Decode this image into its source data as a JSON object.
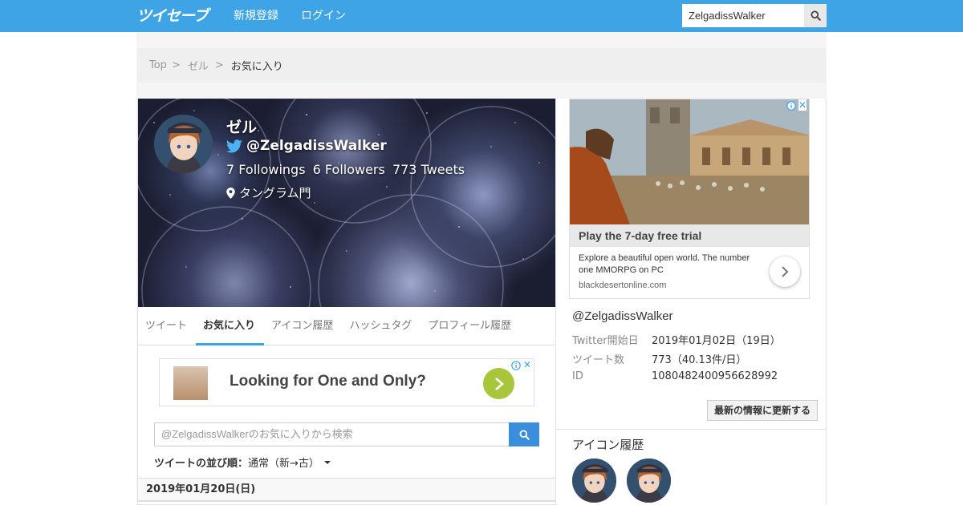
{
  "header": {
    "logo_text": "ツイセーブ",
    "nav": [
      {
        "label": "新規登録"
      },
      {
        "label": "ログイン"
      }
    ],
    "search": {
      "value": "ZelgadissWalker"
    }
  },
  "breadcrumb": {
    "items": [
      "Top",
      "ゼル",
      "お気に入り"
    ],
    "separator": ">"
  },
  "profile": {
    "name": "ゼル",
    "handle": "@ZelgadissWalker",
    "stats": {
      "followings": "7 Followings",
      "followers": "6 Followers",
      "tweets": "773 Tweets"
    },
    "location": "タングラム門"
  },
  "tabs": [
    {
      "label": "ツイート",
      "active": false
    },
    {
      "label": "お気に入り",
      "active": true
    },
    {
      "label": "アイコン履歴",
      "active": false
    },
    {
      "label": "ハッシュタグ",
      "active": false
    },
    {
      "label": "プロフィール履歴",
      "active": false
    }
  ],
  "ad_main": {
    "headline": "Looking for One and Only?",
    "close_glyph": "✕"
  },
  "favorites_search": {
    "placeholder": "@ZelgadissWalkerのお気に入りから検索"
  },
  "sort": {
    "label": "ツイートの並び順：",
    "value": "通常（新→古）"
  },
  "date_header": "2019年01月20日(日)",
  "ad_side": {
    "title": "Play the 7-day free trial",
    "description": "Explore a beautiful open world. The number one MMORPG on PC",
    "domain": "blackdesertonline.com",
    "close_glyph": "✕"
  },
  "account_info": {
    "handle": "@ZelgadissWalker",
    "rows": [
      {
        "label": "Twitter開始日",
        "value": "2019年01月02日（19日）"
      },
      {
        "label": "ツイート数",
        "value": "773（40.13件/日）"
      },
      {
        "label": "ID",
        "value": "1080482400956628992"
      }
    ],
    "refresh_label": "最新の情報に更新する"
  },
  "icon_history": {
    "title": "アイコン履歴",
    "count": 2
  },
  "colors": {
    "header_bg": "#3fa4e6",
    "accent": "#3fa4e6",
    "search_btn": "#3b8edb",
    "ad_button": "#a8c63b"
  }
}
